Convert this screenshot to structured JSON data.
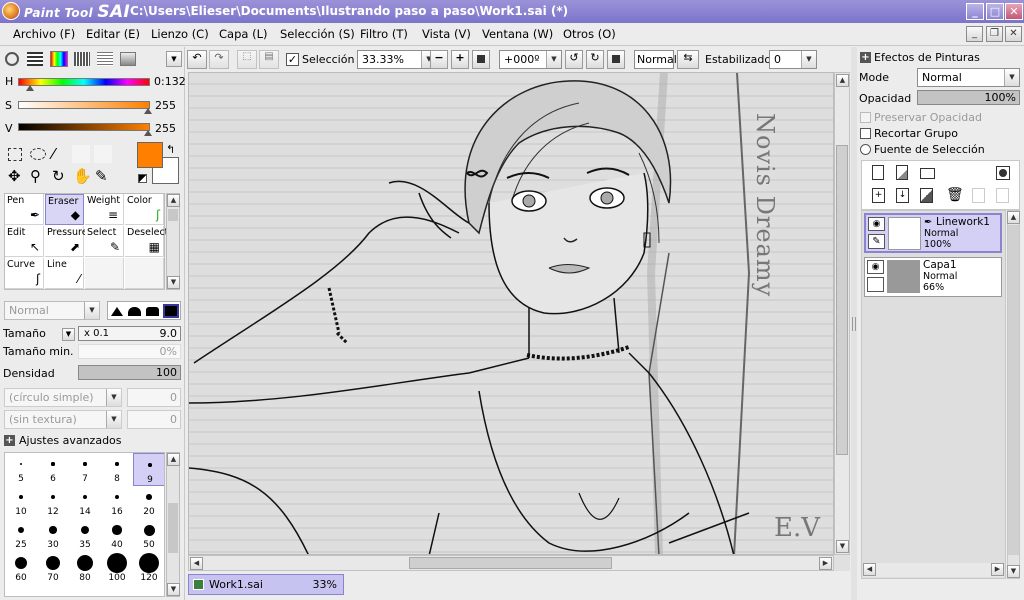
{
  "app": {
    "logo_text_a": "Paint Tool",
    "logo_text_b": "SAI",
    "title": "C:\\Users\\Elieser\\Documents\\Ilustrando paso a paso\\Work1.sai (*)"
  },
  "menu": [
    "Archivo (F)",
    "Editar (E)",
    "Lienzo (C)",
    "Capa (L)",
    "Selección (S)",
    "Filtro (T)",
    "Vista (V)",
    "Ventana (W)",
    "Otros (O)"
  ],
  "toolbar": {
    "selection_label": "Selección",
    "selection_checked": true,
    "zoom": "33.33%",
    "rotation": "+000º",
    "blend": "Normal",
    "stabilizer_label": "Estabilizador",
    "stabilizer_value": "0"
  },
  "colors": {
    "primary": "#ff8000",
    "secondary": "#ffffff",
    "accent": "#8a83cf"
  },
  "hsv": {
    "h_label": "H",
    "h_value": "0:132",
    "s_label": "S",
    "s_value": "255",
    "v_label": "V",
    "v_value": "255"
  },
  "tools": [
    {
      "label": "Pen",
      "icon": "pen-icon"
    },
    {
      "label": "Eraser",
      "icon": "eraser-icon",
      "selected": true
    },
    {
      "label": "Weight",
      "icon": "weight-icon"
    },
    {
      "label": "Color",
      "icon": "color-icon"
    },
    {
      "label": "Edit",
      "icon": "edit-icon"
    },
    {
      "label": "Pressure",
      "icon": "pressure-icon"
    },
    {
      "label": "Select",
      "icon": "select-icon"
    },
    {
      "label": "Deselect",
      "icon": "deselect-icon"
    },
    {
      "label": "Curve",
      "icon": "curve-icon"
    },
    {
      "label": "Line",
      "icon": "line-icon"
    }
  ],
  "brush": {
    "mode": "Normal",
    "size_label": "Tamaño",
    "size_mult": "x 0.1",
    "size_value": "9.0",
    "min_size_label": "Tamaño min.",
    "min_size_value": "0%",
    "density_label": "Densidad",
    "density_value": "100",
    "shape": "(círculo simple)",
    "shape_value": "0",
    "texture": "(sin textura)",
    "texture_value": "0",
    "advanced_label": "Ajustes avanzados"
  },
  "brush_sizes": [
    "5",
    "6",
    "7",
    "8",
    "9",
    "10",
    "12",
    "14",
    "16",
    "20",
    "25",
    "30",
    "35",
    "40",
    "50",
    "60",
    "70",
    "80",
    "100",
    "120"
  ],
  "selected_brush_size": "9",
  "right_panel": {
    "effects_label": "Efectos de Pinturas",
    "mode_label": "Mode",
    "mode_value": "Normal",
    "opacity_label": "Opacidad",
    "opacity_value": "100%",
    "preserve_label": "Preservar Opacidad",
    "clip_label": "Recortar Grupo",
    "source_label": "Fuente de Selección"
  },
  "layers": [
    {
      "name": "Linework1",
      "mode": "Normal",
      "opacity": "100%",
      "selected": true
    },
    {
      "name": "Capa1",
      "mode": "Normal",
      "opacity": "66%",
      "selected": false
    }
  ],
  "canvas_text": {
    "vertical": "Novis Dreamy",
    "corner": "E.V"
  },
  "document_tab": {
    "name": "Work1.sai",
    "zoom": "33%"
  }
}
